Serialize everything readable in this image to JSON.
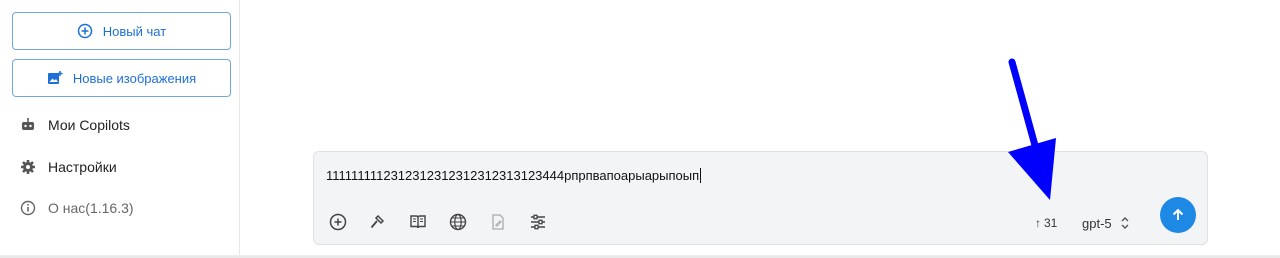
{
  "sidebar": {
    "new_chat_label": "Новый чат",
    "new_images_label": "Новые изображения",
    "items": [
      {
        "label": "Мои Copilots",
        "icon": "robot-icon"
      },
      {
        "label": "Настройки",
        "icon": "gear-icon"
      },
      {
        "label": "О нас(1.16.3)",
        "icon": "info-icon"
      }
    ]
  },
  "composer": {
    "text": "1111111112312312312312312313123444рпрпвапоарыарыпоып",
    "tools": [
      "add-circle-icon",
      "hammer-icon",
      "book-icon",
      "globe-icon",
      "document-edit-icon",
      "sliders-icon"
    ],
    "token_count": "31",
    "model": "gpt-5"
  },
  "colors": {
    "accent": "#1e88e5",
    "outline": "#6fa8dc",
    "annotation_arrow": "#0000ff"
  }
}
